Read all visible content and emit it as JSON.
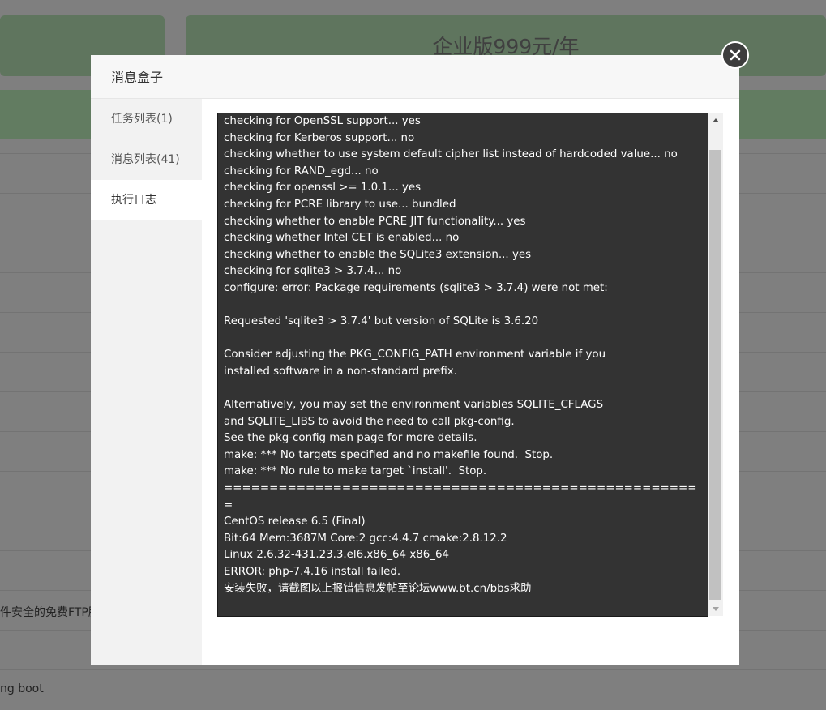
{
  "background": {
    "plan_price": "企业版999元/年",
    "partial_row_text": "件安全的免费FTP服",
    "bottom_row_text": "ng boot"
  },
  "modal": {
    "title": "消息盒子",
    "close_icon": "close-icon",
    "sidebar": [
      {
        "label": "任务列表(1)",
        "active": false
      },
      {
        "label": "消息列表(41)",
        "active": false
      },
      {
        "label": "执行日志",
        "active": true
      }
    ],
    "log_lines": [
      "checking for OpenSSL support... yes",
      "checking for Kerberos support... no",
      "checking whether to use system default cipher list instead of hardcoded value... no",
      "checking for RAND_egd... no",
      "checking for openssl >= 1.0.1... yes",
      "checking for PCRE library to use... bundled",
      "checking whether to enable PCRE JIT functionality... yes",
      "checking whether Intel CET is enabled... no",
      "checking whether to enable the SQLite3 extension... yes",
      "checking for sqlite3 > 3.7.4... no",
      "configure: error: Package requirements (sqlite3 > 3.7.4) were not met:",
      "",
      "Requested 'sqlite3 > 3.7.4' but version of SQLite is 3.6.20",
      "",
      "Consider adjusting the PKG_CONFIG_PATH environment variable if you",
      "installed software in a non-standard prefix.",
      "",
      "Alternatively, you may set the environment variables SQLITE_CFLAGS",
      "and SQLITE_LIBS to avoid the need to call pkg-config.",
      "See the pkg-config man page for more details.",
      "make: *** No targets specified and no makefile found.  Stop.",
      "make: *** No rule to make target `install'.  Stop.",
      "=====================================================",
      "CentOS release 6.5 (Final)",
      "Bit:64 Mem:3687M Core:2 gcc:4.4.7 cmake:2.8.12.2",
      "Linux 2.6.32-431.23.3.el6.x86_64 x86_64",
      "ERROR: php-7.4.16 install failed.",
      "安装失败，请截图以上报错信息发帖至论坛www.bt.cn/bbs求助"
    ]
  }
}
